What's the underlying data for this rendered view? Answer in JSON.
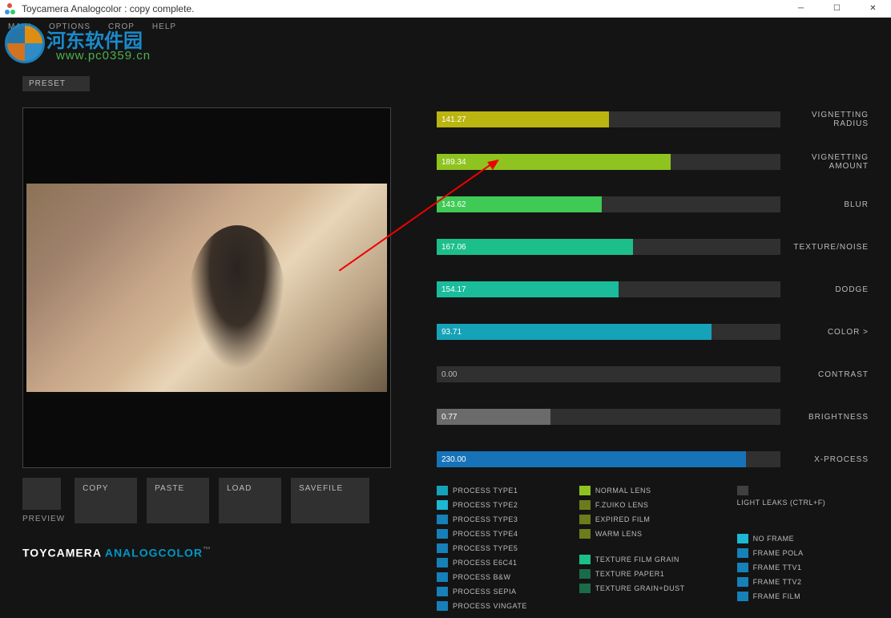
{
  "window": {
    "title": "Toycamera Analogcolor : copy complete."
  },
  "menu": {
    "main": "MAIN",
    "options": "OPTIONS",
    "crop": "CROP",
    "help": "HELP"
  },
  "watermark": {
    "text1": "河东软件园",
    "text2": "www.pc0359.cn"
  },
  "preset": "PRESET",
  "buttons": {
    "copy": "COPY",
    "paste": "PASTE",
    "load": "LOAD",
    "savefile": "SAVEFILE",
    "preview": "PREVIEW"
  },
  "brand": {
    "part1": "TOYCAMERA ",
    "part2": "ANALOGCOLOR",
    "tm": "™"
  },
  "sliders": [
    {
      "value": "141.27",
      "label": "VIGNETTING RADIUS",
      "pct": 50,
      "color": "#bab50f"
    },
    {
      "value": "189.34",
      "label": "VIGNETTING AMOUNT",
      "pct": 68,
      "color": "#8fc31f"
    },
    {
      "value": "143.62",
      "label": "BLUR",
      "pct": 48,
      "color": "#3fc955"
    },
    {
      "value": "167.06",
      "label": "TEXTURE/NOISE",
      "pct": 57,
      "color": "#1cbf8a"
    },
    {
      "value": "154.17",
      "label": "DODGE",
      "pct": 53,
      "color": "#1abc9c"
    },
    {
      "value": "93.71",
      "label": "COLOR >",
      "pct": 80,
      "color": "#16a2b8"
    },
    {
      "value": "0.00",
      "label": "CONTRAST",
      "pct": 0,
      "color": "#6b6b6b"
    },
    {
      "value": "0.77",
      "label": "BRIGHTNESS",
      "pct": 33,
      "color": "#6b6b6b"
    },
    {
      "value": "230.00",
      "label": "X-PROCESS",
      "pct": 90,
      "color": "#1673b8"
    }
  ],
  "opts": {
    "col1": [
      {
        "color": "#16a2b8",
        "label": "PROCESS TYPE1"
      },
      {
        "color": "#1cb8d4",
        "label": "PROCESS TYPE2"
      },
      {
        "color": "#1680b8",
        "label": "PROCESS TYPE3"
      },
      {
        "color": "#1680b8",
        "label": "PROCESS TYPE4"
      },
      {
        "color": "#1680b8",
        "label": "PROCESS TYPE5"
      },
      {
        "color": "#1680b8",
        "label": "PROCESS E6C41"
      },
      {
        "color": "#1680b8",
        "label": "PROCESS B&W"
      },
      {
        "color": "#1680b8",
        "label": "PROCESS SEPIA"
      },
      {
        "color": "#1680b8",
        "label": "PROCESS VINGATE"
      }
    ],
    "col2": [
      {
        "color": "#8fc31f",
        "label": "NORMAL LENS"
      },
      {
        "color": "#6b7d1a",
        "label": "F.ZUIKO LENS"
      },
      {
        "color": "#6b7d1a",
        "label": "EXPIRED FILM"
      },
      {
        "color": "#6b7d1a",
        "label": "WARM LENS"
      },
      {
        "color": "#1cbf8a",
        "label": "TEXTURE FILM GRAIN",
        "gap": true
      },
      {
        "color": "#1a6b4a",
        "label": "TEXTURE PAPER1"
      },
      {
        "color": "#1a6b4a",
        "label": "TEXTURE GRAIN+DUST"
      }
    ],
    "col3_header": {
      "color": "#404040",
      "label": "LIGHT LEAKS (CTRL+F)"
    },
    "col3": [
      {
        "color": "#1cb8d4",
        "label": "NO FRAME"
      },
      {
        "color": "#1680b8",
        "label": "FRAME POLA"
      },
      {
        "color": "#1680b8",
        "label": "FRAME TTV1"
      },
      {
        "color": "#1680b8",
        "label": "FRAME TTV2"
      },
      {
        "color": "#1680b8",
        "label": "FRAME FILM"
      }
    ]
  }
}
